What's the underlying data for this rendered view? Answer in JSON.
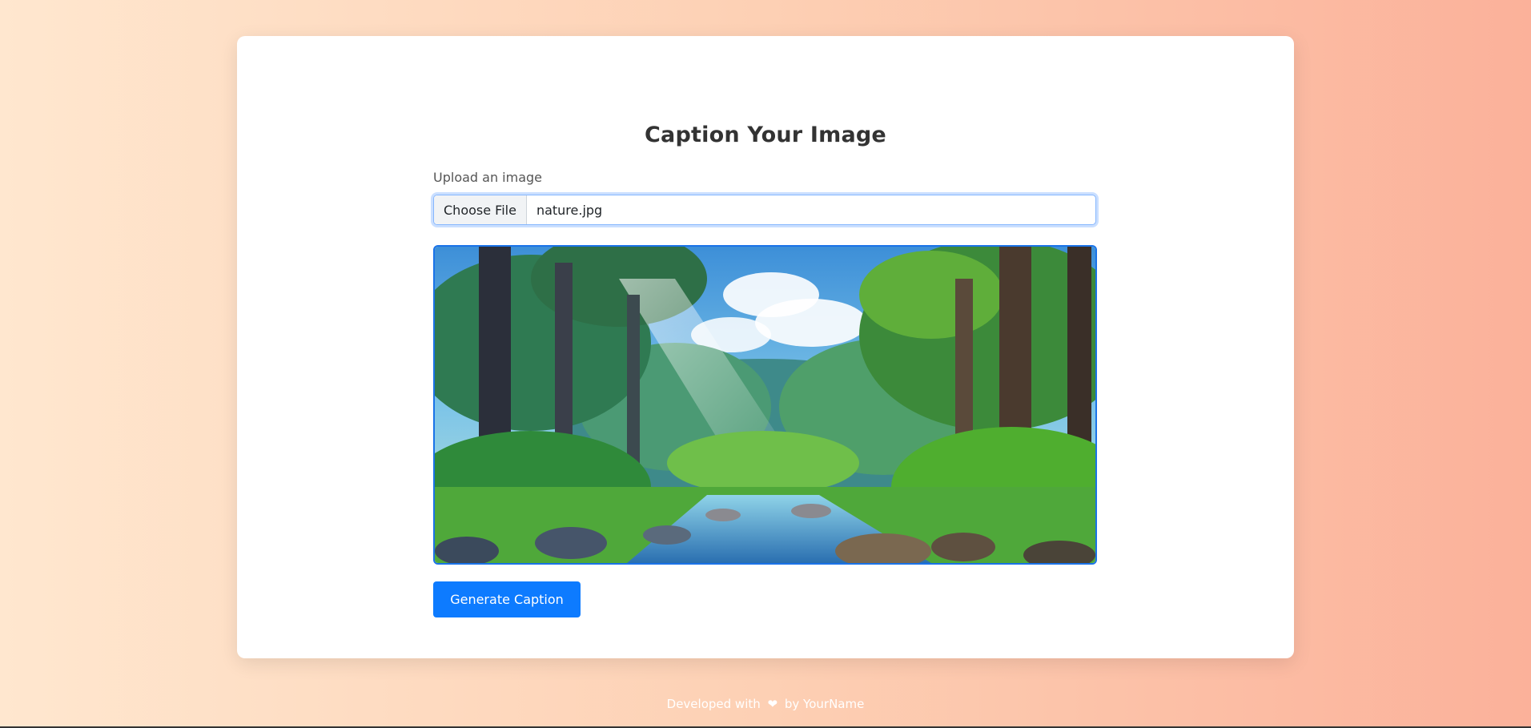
{
  "page": {
    "title": "Caption Your Image"
  },
  "upload": {
    "label": "Upload an image",
    "choose_button": "Choose File",
    "file_name": "nature.jpg"
  },
  "actions": {
    "generate_label": "Generate Caption"
  },
  "footer": {
    "prefix": "Developed with",
    "heart_icon": "heart-icon",
    "suffix": "by YourName"
  },
  "colors": {
    "accent": "#0d7bff",
    "focus_border": "#86b7fe",
    "preview_border": "#1a73e8"
  }
}
